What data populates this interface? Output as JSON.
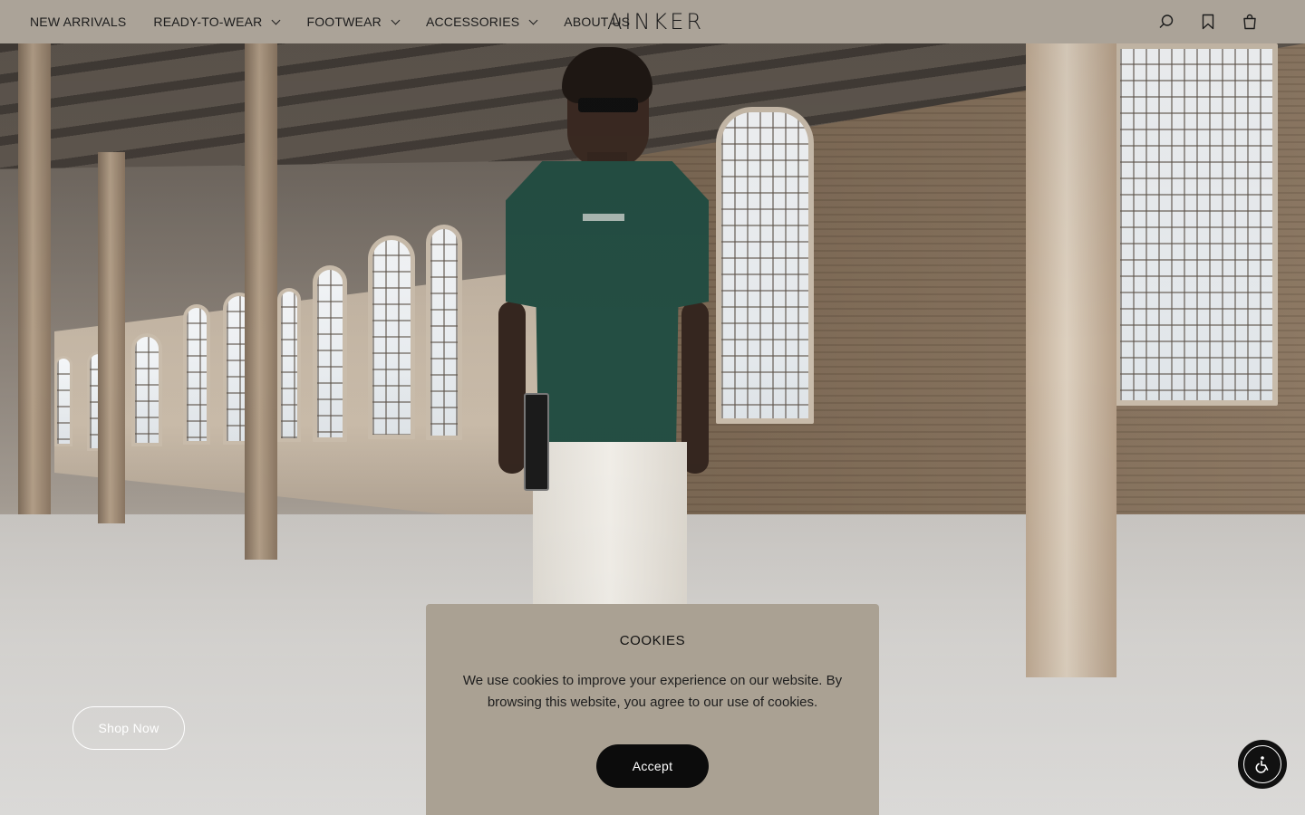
{
  "header": {
    "nav": [
      {
        "label": "NEW ARRIVALS",
        "has_dropdown": false
      },
      {
        "label": "READY-TO-WEAR",
        "has_dropdown": true
      },
      {
        "label": "FOOTWEAR",
        "has_dropdown": true
      },
      {
        "label": "ACCESSORIES",
        "has_dropdown": true
      },
      {
        "label": "ABOUT US",
        "has_dropdown": false
      }
    ],
    "logo": "AINKER",
    "icons": [
      "search-icon",
      "bookmark-icon",
      "bag-icon"
    ]
  },
  "hero": {
    "cta_label": "Shop Now"
  },
  "cookie_dialog": {
    "title": "COOKIES",
    "message": "We use cookies to improve your experience on our website. By browsing this website, you agree to our use of cookies.",
    "accept_label": "Accept"
  },
  "accessibility": {
    "icon": "accessibility-icon"
  },
  "colors": {
    "header_bg": "#aba398",
    "dialog_bg": "#aaa193",
    "accept_bg": "#0c0c0c"
  }
}
